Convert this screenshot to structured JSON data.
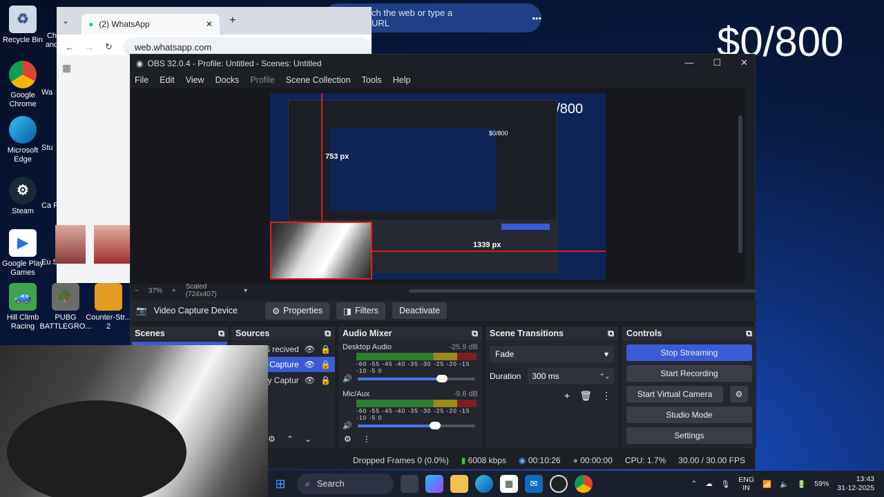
{
  "desktop": {
    "amount": "$0/800",
    "icons": [
      {
        "label": "Recycle Bin"
      },
      {
        "label": "Google Chrome"
      },
      {
        "label": "Microsoft Edge"
      },
      {
        "label": "Steam"
      },
      {
        "label": "Google Play Games"
      },
      {
        "label": "Hill Climb Racing"
      }
    ],
    "icons_col2": [
      {
        "label": "Ch and"
      },
      {
        "label": "Wa"
      },
      {
        "label": "Stu"
      },
      {
        "label": "Ca R"
      },
      {
        "label": "Eu Sir"
      },
      {
        "label": "PUBG BATTLEGRO..."
      },
      {
        "label": "Counter-Str... 2"
      }
    ]
  },
  "chrome": {
    "tab_title": "(2) WhatsApp",
    "url": "web.whatsapp.com",
    "new_tab_hint": "ch the web or type a URL"
  },
  "obs": {
    "title": "OBS 32.0.4 - Profile: Untitled - Scenes: Untitled",
    "menu": [
      "File",
      "Edit",
      "View",
      "Docks",
      "Profile",
      "Scene Collection",
      "Tools",
      "Help"
    ],
    "preview": {
      "amount": "$0/800",
      "height_label": "753 px",
      "width_label": "1339 px",
      "inner_amount": "$0/800"
    },
    "zoom": "37%",
    "scaled": "Scaled (724x407)",
    "source_bar": {
      "selected_source": "Video Capture Device",
      "properties": "Properties",
      "filters": "Filters",
      "deactivate": "Deactivate"
    },
    "scenes": {
      "title": "Scenes"
    },
    "sources": {
      "title": "Sources",
      "items": [
        "$ recived",
        "Capture",
        "ay Captur"
      ]
    },
    "audio_mixer": {
      "title": "Audio Mixer",
      "channels": [
        {
          "name": "Desktop Audio",
          "db": "-25.9 dB",
          "level": 0.72
        },
        {
          "name": "Mic/Aux",
          "db": "-9.6 dB",
          "level": 0.66
        }
      ],
      "scale": "-60 -55 -45 -40 -35 -30 -25 -20 -15 -10 -5 0"
    },
    "transitions": {
      "title": "Scene Transitions",
      "transition": "Fade",
      "duration_label": "Duration",
      "duration_value": "300 ms"
    },
    "controls": {
      "title": "Controls",
      "stop_streaming": "Stop Streaming",
      "start_recording": "Start Recording",
      "start_virtual_camera": "Start Virtual Camera",
      "studio_mode": "Studio Mode",
      "settings": "Settings"
    },
    "status": {
      "dropped_frames": "Dropped Frames 0 (0.0%)",
      "bitrate": "6008 kbps",
      "stream_time": "00:10:26",
      "record_time": "00:00:00",
      "cpu": "CPU: 1.7%",
      "fps": "30.00 / 30.00 FPS"
    }
  },
  "taskbar": {
    "search": "Search",
    "lang": "ENG",
    "region": "IN",
    "battery": "59%",
    "time": "13:43",
    "date": "31-12-2025"
  },
  "colors": {
    "accent": "#3b5bd9",
    "obs_bg": "#1d1f26",
    "panel_bg": "#23262e"
  }
}
